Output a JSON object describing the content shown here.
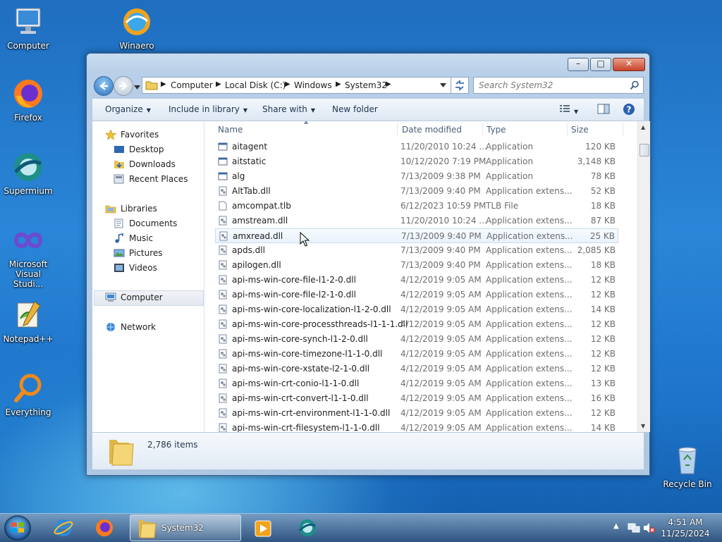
{
  "desktop": {
    "icons": [
      {
        "label": "Computer"
      },
      {
        "label": "Winaero"
      },
      {
        "label": "Firefox"
      },
      {
        "label": "Supermium"
      },
      {
        "label": "Microsoft Visual Studi..."
      },
      {
        "label": "Notepad++"
      },
      {
        "label": "Everything"
      },
      {
        "label": "Recycle Bin"
      }
    ]
  },
  "window": {
    "caption_buttons": {
      "minimize": "–",
      "maximize": "□",
      "close": "✕"
    },
    "breadcrumb": [
      "Computer",
      "Local Disk (C:)",
      "Windows",
      "System32"
    ],
    "search_placeholder": "Search System32",
    "commands": {
      "organize": "Organize",
      "include_in_library": "Include in library",
      "share_with": "Share with",
      "new_folder": "New folder"
    },
    "nav_pane": {
      "favorites": "Favorites",
      "desktop": "Desktop",
      "downloads": "Downloads",
      "recent_places": "Recent Places",
      "libraries": "Libraries",
      "documents": "Documents",
      "music": "Music",
      "pictures": "Pictures",
      "videos": "Videos",
      "computer": "Computer",
      "network": "Network"
    },
    "columns": {
      "name": "Name",
      "date": "Date modified",
      "type": "Type",
      "size": "Size"
    },
    "files": [
      {
        "name": "aitagent",
        "date": "11/20/2010 10:24 ...",
        "type": "Application",
        "size": "120 KB",
        "icon": "exe"
      },
      {
        "name": "aitstatic",
        "date": "10/12/2020 7:19 PM",
        "type": "Application",
        "size": "3,148 KB",
        "icon": "exe"
      },
      {
        "name": "alg",
        "date": "7/13/2009 9:38 PM",
        "type": "Application",
        "size": "78 KB",
        "icon": "exe"
      },
      {
        "name": "AltTab.dll",
        "date": "7/13/2009 9:40 PM",
        "type": "Application extens...",
        "size": "52 KB",
        "icon": "dll"
      },
      {
        "name": "amcompat.tlb",
        "date": "6/12/2023 10:59 PM",
        "type": "TLB File",
        "size": "18 KB",
        "icon": "file"
      },
      {
        "name": "amstream.dll",
        "date": "11/20/2010 10:24 ...",
        "type": "Application extens...",
        "size": "87 KB",
        "icon": "dll"
      },
      {
        "name": "amxread.dll",
        "date": "7/13/2009 9:40 PM",
        "type": "Application extens...",
        "size": "25 KB",
        "icon": "dll"
      },
      {
        "name": "apds.dll",
        "date": "7/13/2009 9:40 PM",
        "type": "Application extens...",
        "size": "2,085 KB",
        "icon": "dll"
      },
      {
        "name": "apilogen.dll",
        "date": "7/13/2009 9:40 PM",
        "type": "Application extens...",
        "size": "18 KB",
        "icon": "dll"
      },
      {
        "name": "api-ms-win-core-file-l1-2-0.dll",
        "date": "4/12/2019 9:05 AM",
        "type": "Application extens...",
        "size": "12 KB",
        "icon": "dll"
      },
      {
        "name": "api-ms-win-core-file-l2-1-0.dll",
        "date": "4/12/2019 9:05 AM",
        "type": "Application extens...",
        "size": "12 KB",
        "icon": "dll"
      },
      {
        "name": "api-ms-win-core-localization-l1-2-0.dll",
        "date": "4/12/2019 9:05 AM",
        "type": "Application extens...",
        "size": "14 KB",
        "icon": "dll"
      },
      {
        "name": "api-ms-win-core-processthreads-l1-1-1.dll",
        "date": "4/12/2019 9:05 AM",
        "type": "Application extens...",
        "size": "12 KB",
        "icon": "dll"
      },
      {
        "name": "api-ms-win-core-synch-l1-2-0.dll",
        "date": "4/12/2019 9:05 AM",
        "type": "Application extens...",
        "size": "12 KB",
        "icon": "dll"
      },
      {
        "name": "api-ms-win-core-timezone-l1-1-0.dll",
        "date": "4/12/2019 9:05 AM",
        "type": "Application extens...",
        "size": "12 KB",
        "icon": "dll"
      },
      {
        "name": "api-ms-win-core-xstate-l2-1-0.dll",
        "date": "4/12/2019 9:05 AM",
        "type": "Application extens...",
        "size": "12 KB",
        "icon": "dll"
      },
      {
        "name": "api-ms-win-crt-conio-l1-1-0.dll",
        "date": "4/12/2019 9:05 AM",
        "type": "Application extens...",
        "size": "13 KB",
        "icon": "dll"
      },
      {
        "name": "api-ms-win-crt-convert-l1-1-0.dll",
        "date": "4/12/2019 9:05 AM",
        "type": "Application extens...",
        "size": "16 KB",
        "icon": "dll"
      },
      {
        "name": "api-ms-win-crt-environment-l1-1-0.dll",
        "date": "4/12/2019 9:05 AM",
        "type": "Application extens...",
        "size": "12 KB",
        "icon": "dll"
      },
      {
        "name": "api-ms-win-crt-filesystem-l1-1-0.dll",
        "date": "4/12/2019 9:05 AM",
        "type": "Application extens...",
        "size": "14 KB",
        "icon": "dll"
      }
    ],
    "selected_file": "amxread.dll",
    "item_count": "2,786 items"
  },
  "taskbar": {
    "active_app": "System32",
    "clock_time": "4:51 AM",
    "clock_date": "11/25/2024"
  },
  "colors": {
    "accent": "#2a72c0",
    "selection": "#e9f2fc"
  }
}
